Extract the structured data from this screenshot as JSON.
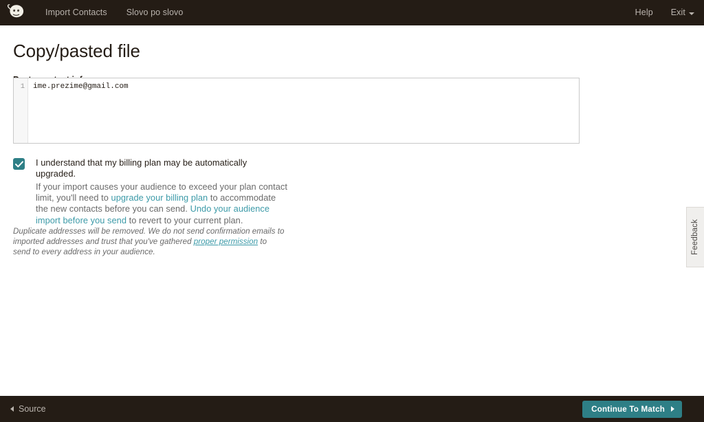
{
  "header": {
    "logo_name": "mailchimp-freddie-logo",
    "nav_items": [
      {
        "label": "Import Contacts"
      },
      {
        "label": "Slovo po slovo"
      }
    ],
    "help_label": "Help",
    "exit_label": "Exit"
  },
  "main": {
    "title": "Copy/pasted file",
    "paste_label": "Paste contact info",
    "editor": {
      "line_number": "1",
      "value": "ime.prezime@gmail.com"
    },
    "consent": {
      "checked": true,
      "title": "I understand that my billing plan may be automatically upgraded.",
      "body_part1": "If your import causes your audience to exceed your plan contact limit, you'll need to ",
      "link1": "upgrade your billing plan",
      "body_part2": " to accommodate the new contacts before you can send. ",
      "link2": "Undo your audience import before you send",
      "body_part3": " to revert to your current plan."
    },
    "disclaimer": {
      "part1": "Duplicate addresses will be removed. We do not send confirmation emails to imported addresses and trust that you've gathered ",
      "link": "proper permission",
      "part2": " to send to every address in your audience."
    }
  },
  "feedback": {
    "label": "Feedback"
  },
  "footer": {
    "back_label": "Source",
    "continue_label": "Continue To Match"
  },
  "colors": {
    "bar_background": "#241c15",
    "accent_teal": "#2e7f86",
    "link_teal": "#3c9aa8",
    "nav_text": "#b9b3ad"
  }
}
